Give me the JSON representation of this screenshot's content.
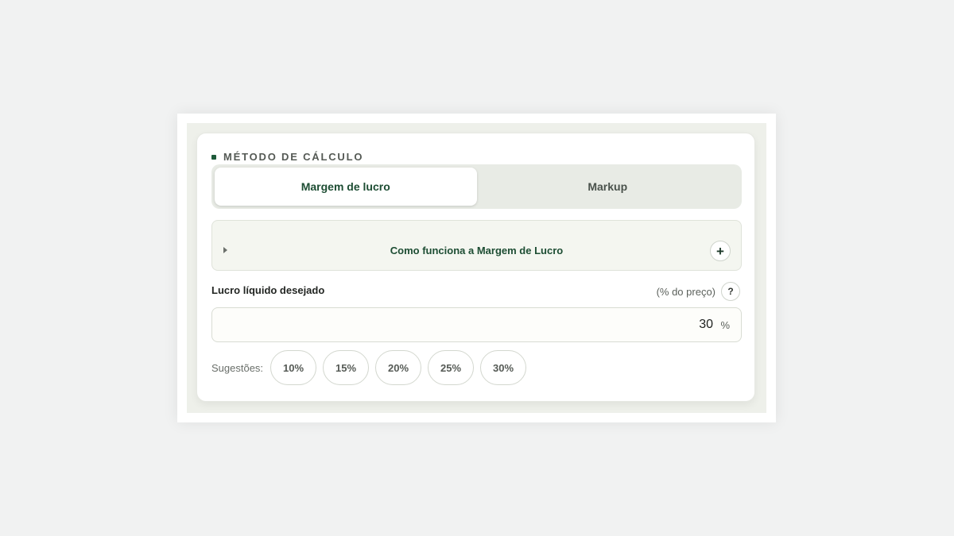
{
  "section": {
    "title": "MÉTODO DE CÁLCULO"
  },
  "tabs": [
    {
      "label": "Margem de lucro",
      "active": true
    },
    {
      "label": "Markup",
      "active": false
    }
  ],
  "accordion": {
    "label": "Como funciona a Margem de Lucro",
    "toggle_icon": "plus-icon",
    "caret_icon": "caret-right-icon"
  },
  "field": {
    "label": "Lucro líquido desejado",
    "hint": "(% do preço)",
    "help_label": "?",
    "value": "30",
    "unit": "%"
  },
  "suggestions": {
    "label": "Sugestões:",
    "options": [
      "10%",
      "15%",
      "20%",
      "25%",
      "30%"
    ]
  },
  "colors": {
    "accent": "#1d4d33",
    "background": "#f1f2f2",
    "panel": "#eef0ea"
  }
}
